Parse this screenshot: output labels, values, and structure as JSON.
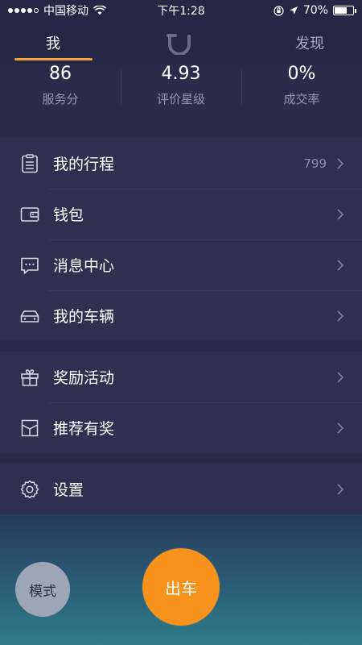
{
  "status_bar": {
    "carrier": "中国移动",
    "time": "下午1:28",
    "battery": "70%",
    "battery_level": 0.7
  },
  "nav": {
    "tab_me": "我",
    "tab_discover": "发现",
    "logo_icon": "didi-logo-icon"
  },
  "stats": [
    {
      "value": "86",
      "label": "服务分"
    },
    {
      "value": "4.93",
      "label": "评价星级"
    },
    {
      "value": "0%",
      "label": "成交率"
    }
  ],
  "menu": {
    "trips": {
      "label": "我的行程",
      "value": "799",
      "icon": "clipboard-icon"
    },
    "wallet": {
      "label": "钱包",
      "icon": "wallet-icon"
    },
    "messages": {
      "label": "消息中心",
      "icon": "message-icon"
    },
    "vehicle": {
      "label": "我的车辆",
      "icon": "car-icon"
    },
    "rewards": {
      "label": "奖励活动",
      "icon": "gift-icon"
    },
    "referral": {
      "label": "推荐有奖",
      "icon": "envelope-icon"
    },
    "settings": {
      "label": "设置",
      "icon": "gear-icon"
    }
  },
  "bottom": {
    "mode_label": "模式",
    "depart_label": "出车"
  },
  "colors": {
    "accent": "#f7921d",
    "background": "#2b2c4a",
    "row_background": "#2f3050"
  }
}
